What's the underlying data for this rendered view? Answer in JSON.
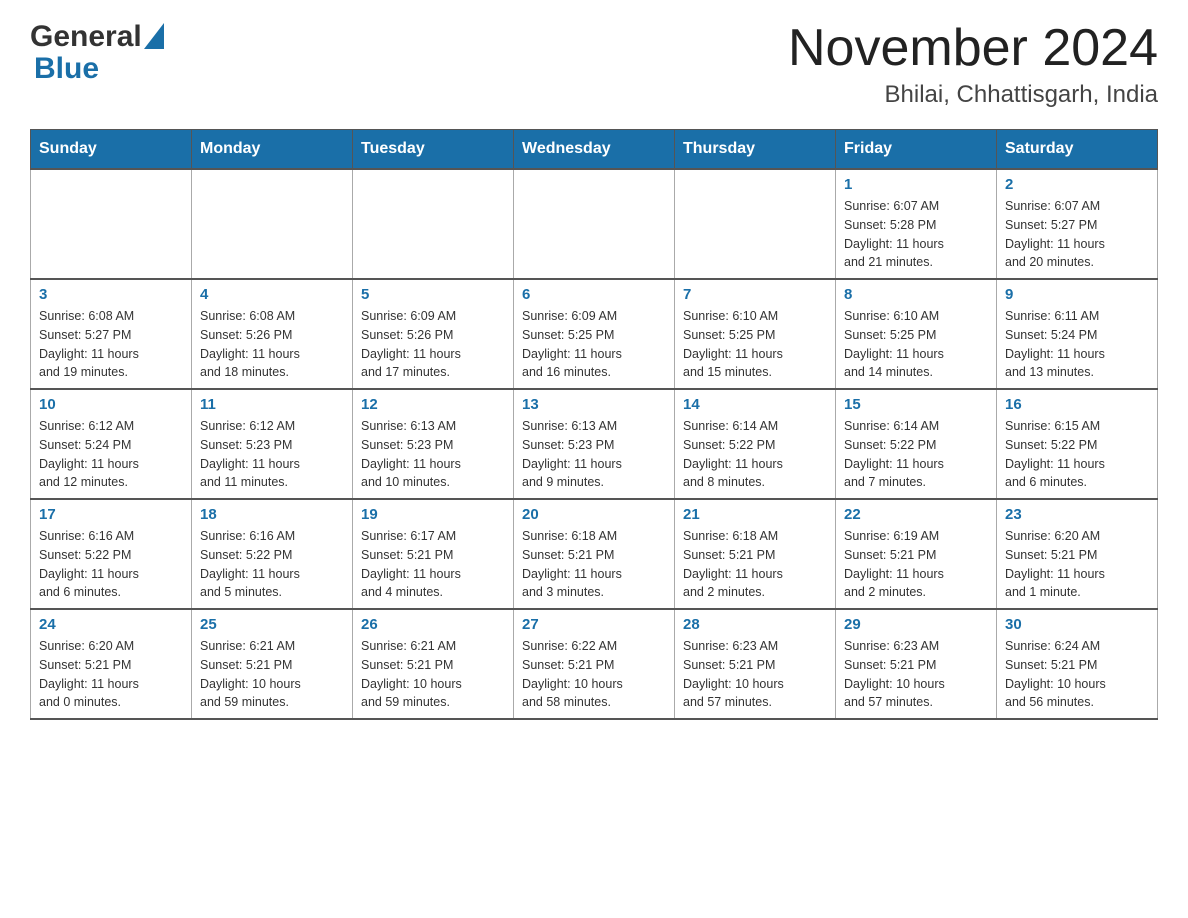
{
  "header": {
    "logo_general": "General",
    "logo_blue": "Blue",
    "month_title": "November 2024",
    "location": "Bhilai, Chhattisgarh, India"
  },
  "days_of_week": [
    "Sunday",
    "Monday",
    "Tuesday",
    "Wednesday",
    "Thursday",
    "Friday",
    "Saturday"
  ],
  "weeks": [
    [
      {
        "day": "",
        "info": ""
      },
      {
        "day": "",
        "info": ""
      },
      {
        "day": "",
        "info": ""
      },
      {
        "day": "",
        "info": ""
      },
      {
        "day": "",
        "info": ""
      },
      {
        "day": "1",
        "info": "Sunrise: 6:07 AM\nSunset: 5:28 PM\nDaylight: 11 hours\nand 21 minutes."
      },
      {
        "day": "2",
        "info": "Sunrise: 6:07 AM\nSunset: 5:27 PM\nDaylight: 11 hours\nand 20 minutes."
      }
    ],
    [
      {
        "day": "3",
        "info": "Sunrise: 6:08 AM\nSunset: 5:27 PM\nDaylight: 11 hours\nand 19 minutes."
      },
      {
        "day": "4",
        "info": "Sunrise: 6:08 AM\nSunset: 5:26 PM\nDaylight: 11 hours\nand 18 minutes."
      },
      {
        "day": "5",
        "info": "Sunrise: 6:09 AM\nSunset: 5:26 PM\nDaylight: 11 hours\nand 17 minutes."
      },
      {
        "day": "6",
        "info": "Sunrise: 6:09 AM\nSunset: 5:25 PM\nDaylight: 11 hours\nand 16 minutes."
      },
      {
        "day": "7",
        "info": "Sunrise: 6:10 AM\nSunset: 5:25 PM\nDaylight: 11 hours\nand 15 minutes."
      },
      {
        "day": "8",
        "info": "Sunrise: 6:10 AM\nSunset: 5:25 PM\nDaylight: 11 hours\nand 14 minutes."
      },
      {
        "day": "9",
        "info": "Sunrise: 6:11 AM\nSunset: 5:24 PM\nDaylight: 11 hours\nand 13 minutes."
      }
    ],
    [
      {
        "day": "10",
        "info": "Sunrise: 6:12 AM\nSunset: 5:24 PM\nDaylight: 11 hours\nand 12 minutes."
      },
      {
        "day": "11",
        "info": "Sunrise: 6:12 AM\nSunset: 5:23 PM\nDaylight: 11 hours\nand 11 minutes."
      },
      {
        "day": "12",
        "info": "Sunrise: 6:13 AM\nSunset: 5:23 PM\nDaylight: 11 hours\nand 10 minutes."
      },
      {
        "day": "13",
        "info": "Sunrise: 6:13 AM\nSunset: 5:23 PM\nDaylight: 11 hours\nand 9 minutes."
      },
      {
        "day": "14",
        "info": "Sunrise: 6:14 AM\nSunset: 5:22 PM\nDaylight: 11 hours\nand 8 minutes."
      },
      {
        "day": "15",
        "info": "Sunrise: 6:14 AM\nSunset: 5:22 PM\nDaylight: 11 hours\nand 7 minutes."
      },
      {
        "day": "16",
        "info": "Sunrise: 6:15 AM\nSunset: 5:22 PM\nDaylight: 11 hours\nand 6 minutes."
      }
    ],
    [
      {
        "day": "17",
        "info": "Sunrise: 6:16 AM\nSunset: 5:22 PM\nDaylight: 11 hours\nand 6 minutes."
      },
      {
        "day": "18",
        "info": "Sunrise: 6:16 AM\nSunset: 5:22 PM\nDaylight: 11 hours\nand 5 minutes."
      },
      {
        "day": "19",
        "info": "Sunrise: 6:17 AM\nSunset: 5:21 PM\nDaylight: 11 hours\nand 4 minutes."
      },
      {
        "day": "20",
        "info": "Sunrise: 6:18 AM\nSunset: 5:21 PM\nDaylight: 11 hours\nand 3 minutes."
      },
      {
        "day": "21",
        "info": "Sunrise: 6:18 AM\nSunset: 5:21 PM\nDaylight: 11 hours\nand 2 minutes."
      },
      {
        "day": "22",
        "info": "Sunrise: 6:19 AM\nSunset: 5:21 PM\nDaylight: 11 hours\nand 2 minutes."
      },
      {
        "day": "23",
        "info": "Sunrise: 6:20 AM\nSunset: 5:21 PM\nDaylight: 11 hours\nand 1 minute."
      }
    ],
    [
      {
        "day": "24",
        "info": "Sunrise: 6:20 AM\nSunset: 5:21 PM\nDaylight: 11 hours\nand 0 minutes."
      },
      {
        "day": "25",
        "info": "Sunrise: 6:21 AM\nSunset: 5:21 PM\nDaylight: 10 hours\nand 59 minutes."
      },
      {
        "day": "26",
        "info": "Sunrise: 6:21 AM\nSunset: 5:21 PM\nDaylight: 10 hours\nand 59 minutes."
      },
      {
        "day": "27",
        "info": "Sunrise: 6:22 AM\nSunset: 5:21 PM\nDaylight: 10 hours\nand 58 minutes."
      },
      {
        "day": "28",
        "info": "Sunrise: 6:23 AM\nSunset: 5:21 PM\nDaylight: 10 hours\nand 57 minutes."
      },
      {
        "day": "29",
        "info": "Sunrise: 6:23 AM\nSunset: 5:21 PM\nDaylight: 10 hours\nand 57 minutes."
      },
      {
        "day": "30",
        "info": "Sunrise: 6:24 AM\nSunset: 5:21 PM\nDaylight: 10 hours\nand 56 minutes."
      }
    ]
  ]
}
